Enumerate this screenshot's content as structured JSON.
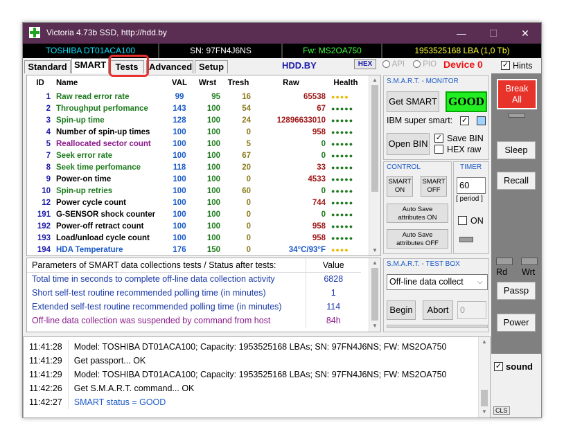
{
  "window": {
    "title": "Victoria 4.73b SSD, http://hdd.by",
    "minimize": "—",
    "maximize": "☐",
    "close": "✕"
  },
  "info": {
    "model": "TOSHIBA DT01ACA100",
    "sn": "SN: 97FN4J6NS",
    "fw": "Fw: MS2OA750",
    "lba": "1953525168 LBA (1,0 Tb)",
    "colors": {
      "model": "#00e5ff",
      "sn": "#ffffff",
      "fw": "#3cff3c",
      "lba": "#ffff33"
    }
  },
  "tabs": [
    "Standard",
    "SMART",
    "Tests",
    "Advanced",
    "Setup"
  ],
  "active_tab": "SMART",
  "toolbar": {
    "hdd_by": "HDD.BY",
    "hex": "HEX",
    "api": "API",
    "pio": "PIO",
    "device": "Device 0",
    "hints": "Hints",
    "hints_checked": "✓"
  },
  "smart_table": {
    "headers": [
      "ID",
      "Name",
      "VAL",
      "Wrst",
      "Tresh",
      "Raw",
      "Health"
    ],
    "rows": [
      {
        "id": "1",
        "name": "Raw read error rate",
        "val": "99",
        "wrst": "95",
        "tresh": "16",
        "raw": "65538",
        "health": "●●●●",
        "name_color": "#1d7a1d",
        "health_color": "#e8b800"
      },
      {
        "id": "2",
        "name": "Throughput perfomance",
        "val": "143",
        "wrst": "100",
        "tresh": "54",
        "raw": "67",
        "health": "●●●●●",
        "name_color": "#1d7a1d",
        "health_color": "#1d7a1d"
      },
      {
        "id": "3",
        "name": "Spin-up time",
        "val": "128",
        "wrst": "100",
        "tresh": "24",
        "raw": "12896633010",
        "health": "●●●●●",
        "name_color": "#1d7a1d",
        "health_color": "#1d7a1d"
      },
      {
        "id": "4",
        "name": "Number of spin-up times",
        "val": "100",
        "wrst": "100",
        "tresh": "0",
        "raw": "958",
        "health": "●●●●●",
        "name_color": "#000000",
        "health_color": "#1d7a1d"
      },
      {
        "id": "5",
        "name": "Reallocated sector count",
        "val": "100",
        "wrst": "100",
        "tresh": "5",
        "raw": "0",
        "health": "●●●●●",
        "name_color": "#8b1a8b",
        "health_color": "#1d7a1d"
      },
      {
        "id": "7",
        "name": "Seek error rate",
        "val": "100",
        "wrst": "100",
        "tresh": "67",
        "raw": "0",
        "health": "●●●●●",
        "name_color": "#1d7a1d",
        "health_color": "#1d7a1d"
      },
      {
        "id": "8",
        "name": "Seek time perfomance",
        "val": "118",
        "wrst": "100",
        "tresh": "20",
        "raw": "33",
        "health": "●●●●●",
        "name_color": "#1d7a1d",
        "health_color": "#1d7a1d"
      },
      {
        "id": "9",
        "name": "Power-on time",
        "val": "100",
        "wrst": "100",
        "tresh": "0",
        "raw": "4533",
        "health": "●●●●●",
        "name_color": "#000000",
        "health_color": "#1d7a1d"
      },
      {
        "id": "10",
        "name": "Spin-up retries",
        "val": "100",
        "wrst": "100",
        "tresh": "60",
        "raw": "0",
        "health": "●●●●●",
        "name_color": "#1d7a1d",
        "health_color": "#1d7a1d"
      },
      {
        "id": "12",
        "name": "Power cycle count",
        "val": "100",
        "wrst": "100",
        "tresh": "0",
        "raw": "744",
        "health": "●●●●●",
        "name_color": "#000000",
        "health_color": "#1d7a1d"
      },
      {
        "id": "191",
        "name": "G-SENSOR shock counter",
        "val": "100",
        "wrst": "100",
        "tresh": "0",
        "raw": "0",
        "health": "●●●●●",
        "name_color": "#000000",
        "health_color": "#1d7a1d"
      },
      {
        "id": "192",
        "name": "Power-off retract count",
        "val": "100",
        "wrst": "100",
        "tresh": "0",
        "raw": "958",
        "health": "●●●●●",
        "name_color": "#000000",
        "health_color": "#1d7a1d"
      },
      {
        "id": "193",
        "name": "Load/unload cycle count",
        "val": "100",
        "wrst": "100",
        "tresh": "0",
        "raw": "958",
        "health": "●●●●●",
        "name_color": "#000000",
        "health_color": "#1d7a1d"
      },
      {
        "id": "194",
        "name": "HDA Temperature",
        "val": "176",
        "wrst": "150",
        "tresh": "0",
        "raw": "34°C/93°F",
        "health": "●●●●",
        "name_color": "#1a5ac8",
        "health_color": "#e8b800"
      }
    ]
  },
  "params_table": {
    "header_label": "Parameters of SMART data collections tests / Status after tests:",
    "header_value": "Value",
    "rows": [
      {
        "label": "Total time in seconds to complete off-line data collection activity",
        "value": "6828",
        "color": "#1a3aa8"
      },
      {
        "label": "Short self-test routine recommended polling time (in minutes)",
        "value": "1",
        "color": "#1a3aa8"
      },
      {
        "label": "Extended self-test routine recommended polling time (in minutes)",
        "value": "114",
        "color": "#1a3aa8"
      },
      {
        "label": "Off-line data collection was suspended by command from host",
        "value": "84h",
        "color": "#8b1a8b"
      }
    ]
  },
  "log": [
    {
      "time": "11:41:28",
      "msg": "Model: TOSHIBA DT01ACA100; Capacity: 1953525168 LBAs; SN: 97FN4J6NS; FW: MS2OA750",
      "color": "#000000"
    },
    {
      "time": "11:41:29",
      "msg": "Get passport... OK",
      "color": "#000000"
    },
    {
      "time": "11:41:29",
      "msg": "Model: TOSHIBA DT01ACA100; Capacity: 1953525168 LBAs; SN: 97FN4J6NS; FW: MS2OA750",
      "color": "#000000"
    },
    {
      "time": "11:42:26",
      "msg": "Get S.M.A.R.T. command... OK",
      "color": "#000000"
    },
    {
      "time": "11:42:27",
      "msg": "SMART status = GOOD",
      "color": "#1a5ac8"
    }
  ],
  "monitor": {
    "title": "S.M.A.R.T. - MONITOR",
    "get_smart": "Get SMART",
    "status": "GOOD",
    "ibm_label": "IBM super smart:",
    "ibm_checked": "✓",
    "open_bin": "Open BIN",
    "save_bin": "Save BIN",
    "save_bin_checked": "✓",
    "hex_raw": "HEX raw"
  },
  "control": {
    "title": "CONTROL",
    "smart_on": [
      "SMART",
      "ON"
    ],
    "smart_off": [
      "SMART",
      "OFF"
    ],
    "auto_on": [
      "Auto Save",
      "attributes ON"
    ],
    "auto_off": [
      "Auto Save",
      "attributes OFF"
    ]
  },
  "timer": {
    "title": "TIMER",
    "value": "60",
    "period": "[ period ]",
    "on": "ON"
  },
  "testbox": {
    "title": "S.M.A.R.T. - TEST BOX",
    "select": "Off-line data collect",
    "begin": "Begin",
    "abort": "Abort",
    "value": "0"
  },
  "right": {
    "break_all": [
      "Break",
      "All"
    ],
    "sleep": "Sleep",
    "recall": "Recall",
    "rd": "Rd",
    "wrt": "Wrt",
    "passp": "Passp",
    "power": "Power",
    "sound": "sound",
    "sound_checked": "✓",
    "cls": "CLS"
  }
}
